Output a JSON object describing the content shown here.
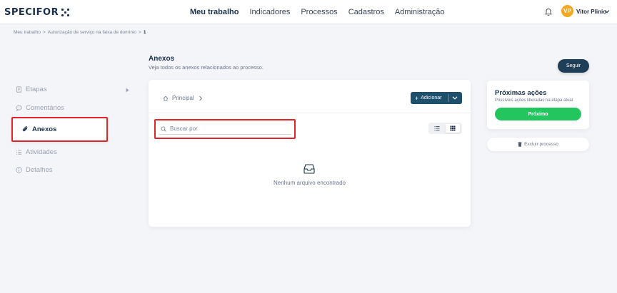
{
  "brand": {
    "logo_text": "SPECIFOR"
  },
  "nav": {
    "items": [
      "Meu trabalho",
      "Indicadores",
      "Processos",
      "Cadastros",
      "Administração"
    ],
    "active_index": 0
  },
  "user": {
    "initials": "VP",
    "name": "Vitor Plinio",
    "avatar_color": "#f5a623"
  },
  "breadcrumb": {
    "items": [
      "Meu trabalho",
      "Autorização de serviço na faixa de domínio",
      "1"
    ],
    "separator": ">"
  },
  "sidebar": {
    "items": [
      {
        "label": "Etapas",
        "icon": "document-icon"
      },
      {
        "label": "Comentários",
        "icon": "comment-icon"
      },
      {
        "label": "Anexos",
        "icon": "paperclip-icon",
        "active": true
      },
      {
        "label": "Atividades",
        "icon": "list-icon"
      },
      {
        "label": "Detalhes",
        "icon": "info-icon"
      }
    ]
  },
  "main": {
    "title": "Anexos",
    "subtitle": "Veja todos os anexos relacionados ao processo.",
    "folder_crumb": "Principal",
    "add_button": "Adicionar",
    "search_placeholder": "Buscar por",
    "view_mode": "grid",
    "empty_message": "Nenhum arquivo encontrado"
  },
  "actions": {
    "follow_button": "Seguir",
    "title": "Próximas ações",
    "subtitle": "Possíveis ações liberadas na etapa atual",
    "next_button": "Próximo",
    "delete_button": "Excluir processo"
  },
  "colors": {
    "primary": "#1e4f6b",
    "follow": "#1e3f57",
    "success": "#22c55e",
    "highlight": "#e0242a"
  }
}
